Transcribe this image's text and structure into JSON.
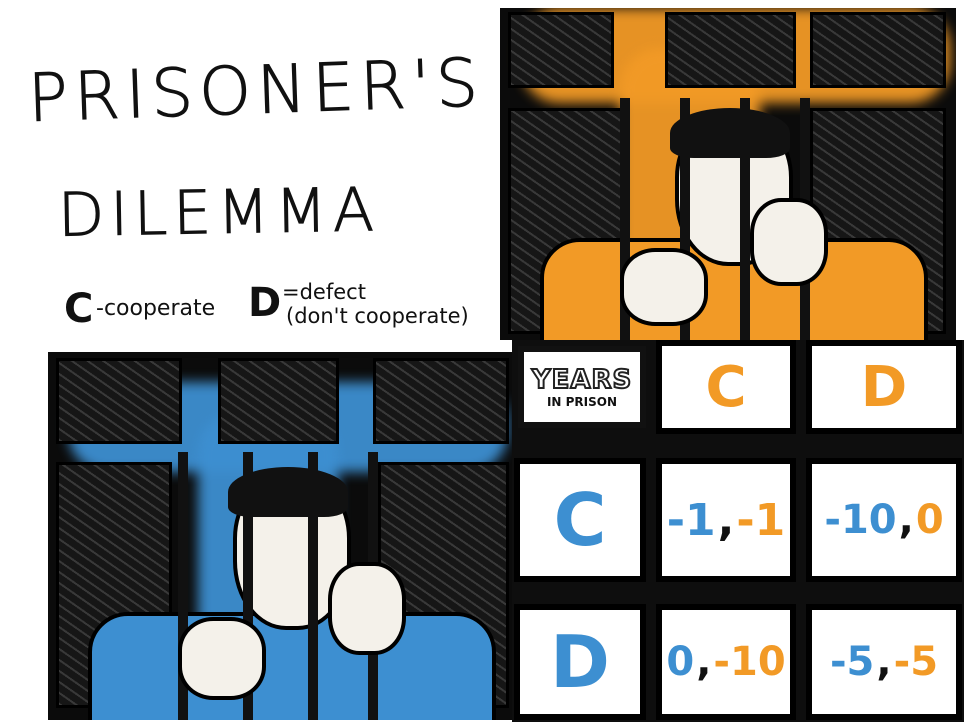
{
  "title": {
    "line1": "PRISONER'S",
    "line2": "DILEMMA"
  },
  "legend": {
    "c_letter": "C",
    "c_text": "-cooperate",
    "d_letter": "D",
    "d_text_1": "=defect",
    "d_text_2": "(don't cooperate)"
  },
  "table": {
    "corner_line1": "YEARS",
    "corner_line2": "IN PRISON",
    "col_headers": [
      "C",
      "D"
    ],
    "row_headers": [
      "C",
      "D"
    ],
    "cells": [
      [
        {
          "a": "-1",
          "b": "-1"
        },
        {
          "a": "-10",
          "b": "0"
        }
      ],
      [
        {
          "a": "0",
          "b": "-10"
        },
        {
          "a": "-5",
          "b": "-5"
        }
      ]
    ]
  },
  "colors": {
    "orange": "#f29a26",
    "blue": "#3d8fd1",
    "ink": "#111111"
  }
}
